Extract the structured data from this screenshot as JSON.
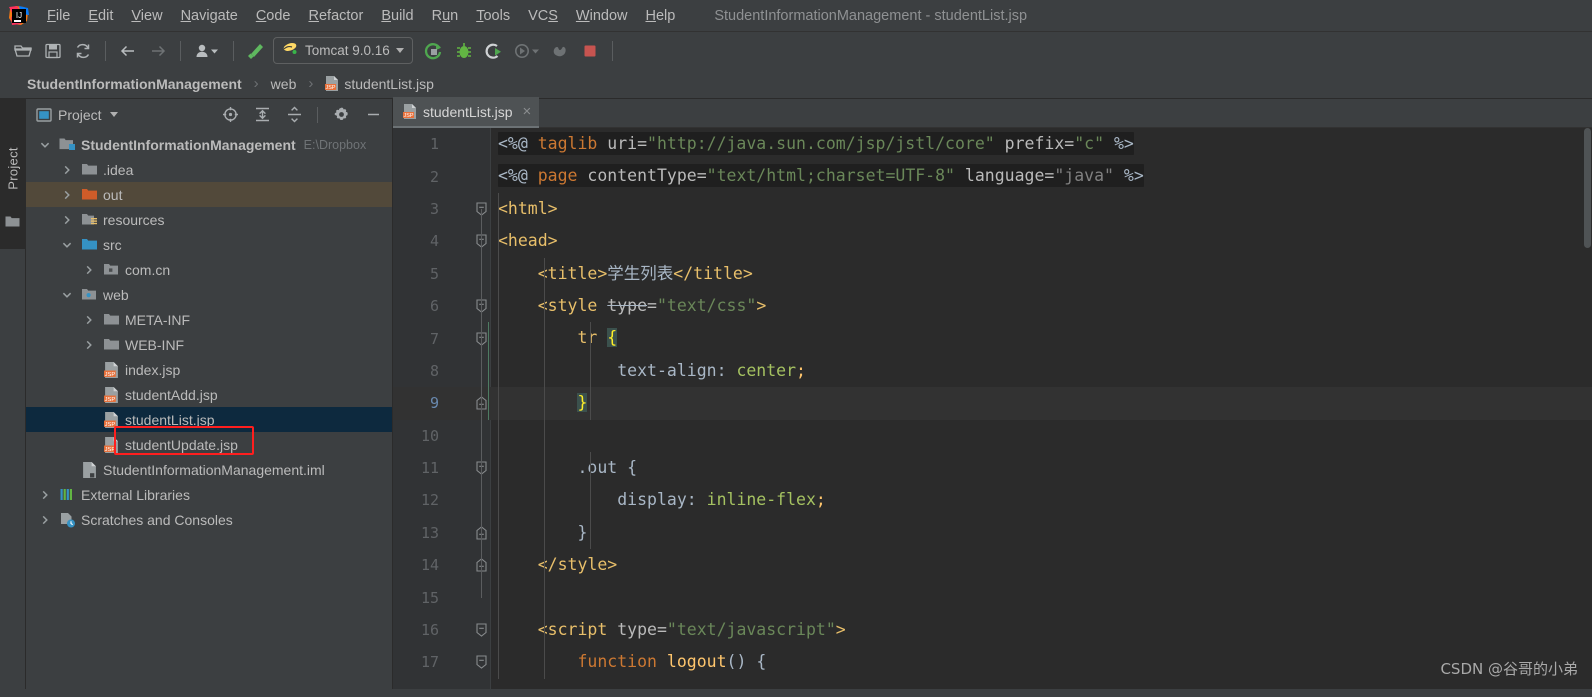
{
  "window": {
    "title": "StudentInformationManagement - studentList.jsp",
    "app_icon": "intellij-idea-logo"
  },
  "menubar": {
    "items": [
      {
        "label": "File",
        "mnemonic": "F"
      },
      {
        "label": "Edit",
        "mnemonic": "E"
      },
      {
        "label": "View",
        "mnemonic": "V"
      },
      {
        "label": "Navigate",
        "mnemonic": "N"
      },
      {
        "label": "Code",
        "mnemonic": "C"
      },
      {
        "label": "Refactor",
        "mnemonic": "R"
      },
      {
        "label": "Build",
        "mnemonic": "B"
      },
      {
        "label": "Run",
        "mnemonic": "u"
      },
      {
        "label": "Tools",
        "mnemonic": "T"
      },
      {
        "label": "VCS",
        "mnemonic": "S"
      },
      {
        "label": "Window",
        "mnemonic": "W"
      },
      {
        "label": "Help",
        "mnemonic": "H"
      }
    ]
  },
  "toolbar": {
    "buttons": [
      {
        "name": "open-folder-icon",
        "tip": "Open"
      },
      {
        "name": "save-all-icon",
        "tip": "Save All"
      },
      {
        "name": "sync-refresh-icon",
        "tip": "Synchronize"
      },
      {
        "name": "back-arrow-icon",
        "tip": "Back"
      },
      {
        "name": "forward-arrow-icon",
        "tip": "Forward"
      },
      {
        "name": "profile-dropdown-icon",
        "tip": "Profiles"
      },
      {
        "name": "build-hammer-icon",
        "tip": "Build Project"
      }
    ],
    "run_config": {
      "label": "Tomcat 9.0.16",
      "icon": "tomcat-icon",
      "dropdown": "chevron-down-icon"
    },
    "run_buttons": [
      {
        "name": "run-icon",
        "tip": "Run",
        "color": "#57a64a"
      },
      {
        "name": "debug-icon",
        "tip": "Debug",
        "color": "#62b543"
      },
      {
        "name": "run-with-coverage-icon",
        "tip": "Run with Coverage",
        "color": "#57a64a"
      },
      {
        "name": "profiler-dropdown-icon",
        "tip": "Profiler",
        "color": "#6e7174"
      },
      {
        "name": "update-application-icon",
        "tip": "Update",
        "color": "#6e7174"
      },
      {
        "name": "stop-icon",
        "tip": "Stop",
        "color": "#c75450"
      }
    ]
  },
  "breadcrumb": {
    "items": [
      {
        "label": "StudentInformationManagement",
        "bold": true,
        "icon": null
      },
      {
        "label": "web",
        "bold": false,
        "icon": null
      },
      {
        "label": "studentList.jsp",
        "bold": false,
        "icon": "jsp-file-icon"
      }
    ],
    "separator": "›"
  },
  "tool_strip": {
    "project_tab": "Project",
    "folder_icon": "folder-icon"
  },
  "project_panel": {
    "title": "Project",
    "title_icon": "project-view-icon",
    "title_dropdown": "chevron-down-icon",
    "actions": [
      {
        "name": "scroll-to-source-icon",
        "tip": "Select Opened File"
      },
      {
        "name": "expand-all-icon",
        "tip": "Expand All"
      },
      {
        "name": "collapse-all-icon",
        "tip": "Collapse All"
      },
      {
        "name": "gear-icon",
        "tip": "Settings"
      },
      {
        "name": "hide-icon",
        "tip": "Hide"
      }
    ],
    "tree": [
      {
        "label": "StudentInformationManagement",
        "sub": "E:\\Dropbox",
        "depth": 0,
        "arrow": "expanded",
        "icon": "module-folder-icon",
        "bold": true,
        "state": "normal"
      },
      {
        "label": ".idea",
        "sub": "",
        "depth": 1,
        "arrow": "collapsed",
        "icon": "folder-icon",
        "bold": false,
        "state": "normal"
      },
      {
        "label": "out",
        "sub": "",
        "depth": 1,
        "arrow": "collapsed",
        "icon": "excluded-folder-icon",
        "bold": false,
        "state": "highlight"
      },
      {
        "label": "resources",
        "sub": "",
        "depth": 1,
        "arrow": "collapsed",
        "icon": "resources-folder-icon",
        "bold": false,
        "state": "normal"
      },
      {
        "label": "src",
        "sub": "",
        "depth": 1,
        "arrow": "expanded",
        "icon": "source-folder-icon",
        "bold": false,
        "state": "normal"
      },
      {
        "label": "com.cn",
        "sub": "",
        "depth": 2,
        "arrow": "collapsed",
        "icon": "package-icon",
        "bold": false,
        "state": "normal"
      },
      {
        "label": "web",
        "sub": "",
        "depth": 1,
        "arrow": "expanded",
        "icon": "web-folder-icon",
        "bold": false,
        "state": "normal"
      },
      {
        "label": "META-INF",
        "sub": "",
        "depth": 2,
        "arrow": "collapsed",
        "icon": "folder-icon",
        "bold": false,
        "state": "normal"
      },
      {
        "label": "WEB-INF",
        "sub": "",
        "depth": 2,
        "arrow": "collapsed",
        "icon": "folder-icon",
        "bold": false,
        "state": "normal"
      },
      {
        "label": "index.jsp",
        "sub": "",
        "depth": 2,
        "arrow": "none",
        "icon": "jsp-file-icon",
        "bold": false,
        "state": "normal"
      },
      {
        "label": "studentAdd.jsp",
        "sub": "",
        "depth": 2,
        "arrow": "none",
        "icon": "jsp-file-icon",
        "bold": false,
        "state": "normal"
      },
      {
        "label": "studentList.jsp",
        "sub": "",
        "depth": 2,
        "arrow": "none",
        "icon": "jsp-file-icon",
        "bold": false,
        "state": "selected"
      },
      {
        "label": "studentUpdate.jsp",
        "sub": "",
        "depth": 2,
        "arrow": "none",
        "icon": "jsp-file-icon",
        "bold": false,
        "state": "normal"
      },
      {
        "label": "StudentInformationManagement.iml",
        "sub": "",
        "depth": 1,
        "arrow": "none",
        "icon": "iml-file-icon",
        "bold": false,
        "state": "normal"
      },
      {
        "label": "External Libraries",
        "sub": "",
        "depth": 0,
        "arrow": "collapsed",
        "icon": "libraries-icon",
        "bold": false,
        "state": "normal"
      },
      {
        "label": "Scratches and Consoles",
        "sub": "",
        "depth": 0,
        "arrow": "collapsed",
        "icon": "scratches-icon",
        "bold": false,
        "state": "normal"
      }
    ],
    "annotation": {
      "color": "#ff1e1e",
      "target": "studentList.jsp"
    }
  },
  "editor": {
    "tabs": [
      {
        "label": "studentList.jsp",
        "icon": "jsp-file-icon",
        "active": true,
        "close": "×"
      }
    ],
    "current_line": 9,
    "lines": [
      {
        "n": 1,
        "fold": "none",
        "tokens": [
          {
            "t": "<%@ ",
            "c": "t-plain"
          },
          {
            "t": "taglib",
            "c": "t-kw"
          },
          {
            "t": " uri=",
            "c": "t-attr"
          },
          {
            "t": "\"http://java.sun.com/jsp/jstl/core\"",
            "c": "t-str"
          },
          {
            "t": " prefix=",
            "c": "t-attr"
          },
          {
            "t": "\"c\"",
            "c": "t-str"
          },
          {
            "t": " %>",
            "c": "t-plain"
          }
        ],
        "jsp_bg": true
      },
      {
        "n": 2,
        "fold": "none",
        "tokens": [
          {
            "t": "<%@ ",
            "c": "t-plain"
          },
          {
            "t": "page",
            "c": "t-kw"
          },
          {
            "t": " contentType=",
            "c": "t-attr"
          },
          {
            "t": "\"text/html;charset=UTF-8\"",
            "c": "t-str"
          },
          {
            "t": " language=",
            "c": "t-attr"
          },
          {
            "t": "\"java\"",
            "c": "t-gray"
          },
          {
            "t": " %>",
            "c": "t-plain"
          }
        ],
        "jsp_bg": true
      },
      {
        "n": 3,
        "fold": "start",
        "tokens": [
          {
            "t": "<html>",
            "c": "t-tag"
          }
        ],
        "jsp_bg": false
      },
      {
        "n": 4,
        "fold": "start",
        "tokens": [
          {
            "t": "<head>",
            "c": "t-tag"
          }
        ],
        "jsp_bg": false
      },
      {
        "n": 5,
        "fold": "none",
        "tokens": [
          {
            "t": "    ",
            "c": "t-plain"
          },
          {
            "t": "<title>",
            "c": "t-tag"
          },
          {
            "t": "学生列表",
            "c": "t-plain"
          },
          {
            "t": "</title>",
            "c": "t-tag"
          }
        ],
        "jsp_bg": false
      },
      {
        "n": 6,
        "fold": "start",
        "tokens": [
          {
            "t": "    ",
            "c": "t-plain"
          },
          {
            "t": "<style ",
            "c": "t-tag"
          },
          {
            "t": "type",
            "c": "t-attr strike"
          },
          {
            "t": "=",
            "c": "t-attr"
          },
          {
            "t": "\"text/css\"",
            "c": "t-str"
          },
          {
            "t": ">",
            "c": "t-tag"
          }
        ],
        "jsp_bg": false
      },
      {
        "n": 7,
        "fold": "start",
        "tokens": [
          {
            "t": "        ",
            "c": "t-plain"
          },
          {
            "t": "tr",
            "c": "t-css-sel"
          },
          {
            "t": " ",
            "c": "t-plain"
          },
          {
            "t": "{",
            "c": "t-brace-m"
          }
        ],
        "jsp_bg": false
      },
      {
        "n": 8,
        "fold": "none",
        "tokens": [
          {
            "t": "            ",
            "c": "t-plain"
          },
          {
            "t": "text-align",
            "c": "t-css-prop"
          },
          {
            "t": ": ",
            "c": "t-punct"
          },
          {
            "t": "center",
            "c": "t-css-val"
          },
          {
            "t": ";",
            "c": "t-brace"
          }
        ],
        "jsp_bg": false
      },
      {
        "n": 9,
        "fold": "end",
        "tokens": [
          {
            "t": "        ",
            "c": "t-plain"
          },
          {
            "t": "}",
            "c": "t-brace-m"
          }
        ],
        "jsp_bg": false
      },
      {
        "n": 10,
        "fold": "none",
        "tokens": [],
        "jsp_bg": false
      },
      {
        "n": 11,
        "fold": "start",
        "tokens": [
          {
            "t": "        ",
            "c": "t-plain"
          },
          {
            "t": ".out",
            "c": "t-plain"
          },
          {
            "t": " {",
            "c": "t-plain"
          }
        ],
        "jsp_bg": false
      },
      {
        "n": 12,
        "fold": "none",
        "tokens": [
          {
            "t": "            ",
            "c": "t-plain"
          },
          {
            "t": "display",
            "c": "t-css-prop"
          },
          {
            "t": ": ",
            "c": "t-punct"
          },
          {
            "t": "inline-flex",
            "c": "t-css-val"
          },
          {
            "t": ";",
            "c": "t-brace"
          }
        ],
        "jsp_bg": false
      },
      {
        "n": 13,
        "fold": "end",
        "tokens": [
          {
            "t": "        ",
            "c": "t-plain"
          },
          {
            "t": "}",
            "c": "t-plain"
          }
        ],
        "jsp_bg": false
      },
      {
        "n": 14,
        "fold": "end",
        "tokens": [
          {
            "t": "    ",
            "c": "t-plain"
          },
          {
            "t": "</style>",
            "c": "t-tag"
          }
        ],
        "jsp_bg": false
      },
      {
        "n": 15,
        "fold": "none",
        "tokens": [],
        "jsp_bg": false
      },
      {
        "n": 16,
        "fold": "start",
        "tokens": [
          {
            "t": "    ",
            "c": "t-plain"
          },
          {
            "t": "<script ",
            "c": "t-tag"
          },
          {
            "t": "type=",
            "c": "t-attr"
          },
          {
            "t": "\"text/javascript\"",
            "c": "t-str"
          },
          {
            "t": ">",
            "c": "t-tag"
          }
        ],
        "jsp_bg": false
      },
      {
        "n": 17,
        "fold": "start",
        "tokens": [
          {
            "t": "        ",
            "c": "t-plain"
          },
          {
            "t": "function",
            "c": "t-kw"
          },
          {
            "t": " ",
            "c": "t-plain"
          },
          {
            "t": "logout",
            "c": "t-fn"
          },
          {
            "t": "() {",
            "c": "t-punct"
          }
        ],
        "jsp_bg": false
      }
    ],
    "gutter_bulb": {
      "line": 9,
      "icon": "lightbulb-icon",
      "color": "#f5a623"
    }
  },
  "watermark": {
    "text": "CSDN @谷哥的小弟"
  },
  "colors": {
    "bg_chrome": "#3c3f41",
    "bg_editor": "#2b2b2b",
    "bg_gutter": "#313335",
    "accent_selection": "#0d293e",
    "accent_annotation": "#ff1e1e",
    "text_primary": "#bbbbbb"
  }
}
